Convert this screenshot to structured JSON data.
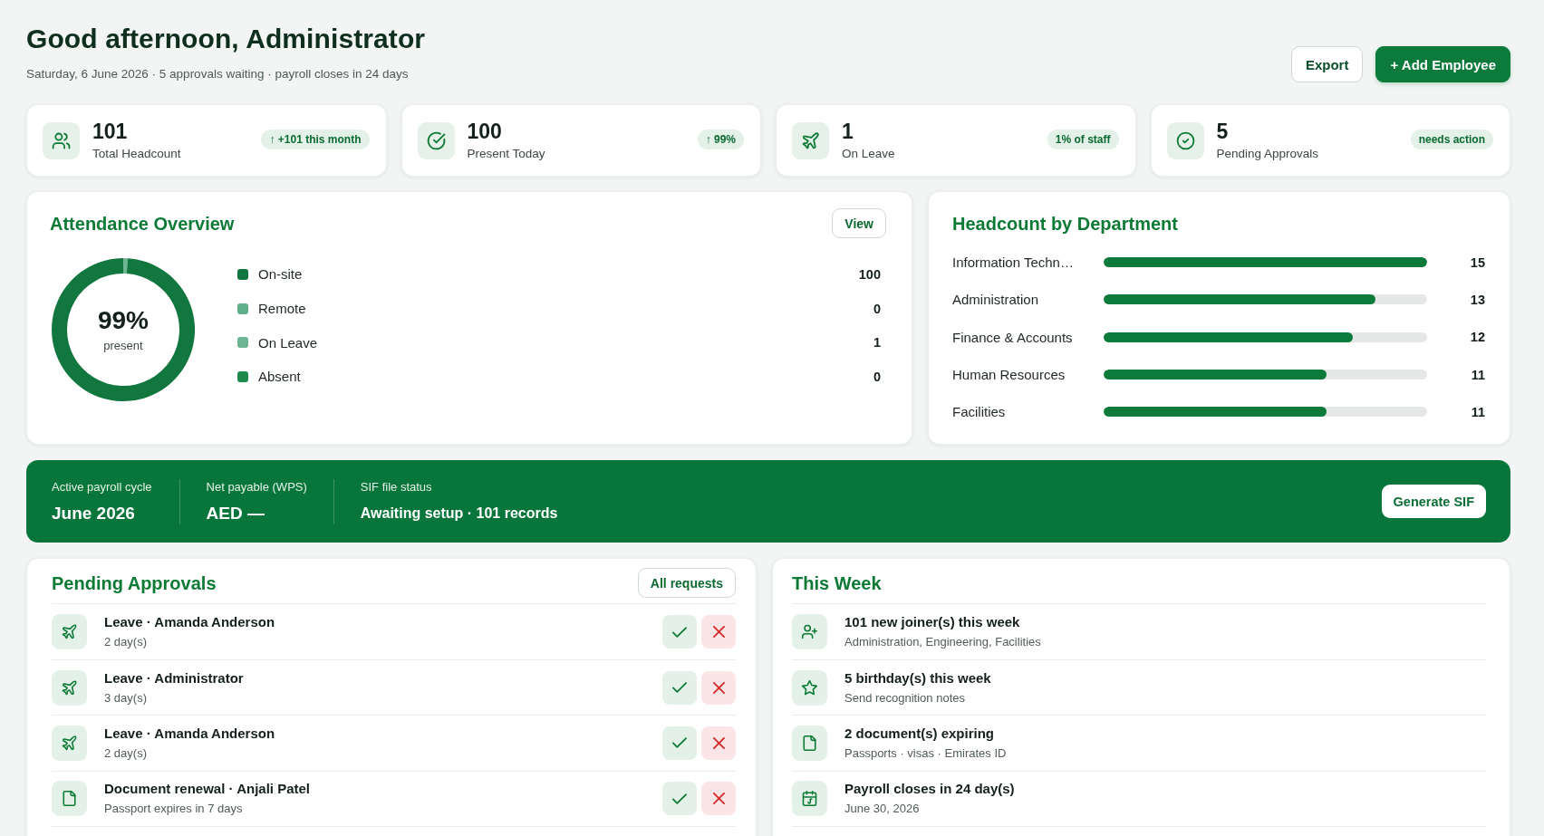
{
  "header": {
    "title": "Good afternoon, Administrator",
    "subtitle": "Saturday, 6 June 2026 · 5 approvals waiting · payroll closes in 24 days",
    "buttons": [
      {
        "label": "Export",
        "kind": "secondary"
      },
      {
        "label": "+ Add Employee",
        "kind": "primary"
      }
    ]
  },
  "stats": [
    {
      "kind": "headcount",
      "value": "101",
      "label": "Total Headcount",
      "badge": "↑ +101 this month"
    },
    {
      "kind": "present",
      "value": "100",
      "label": "Present Today",
      "badge": "↑ 99%"
    },
    {
      "kind": "leave",
      "value": "1",
      "label": "On Leave",
      "badge": "1% of staff"
    },
    {
      "kind": "approvals",
      "value": "5",
      "label": "Pending Approvals",
      "badge": "needs action"
    }
  ],
  "attendance": {
    "title": "Attendance Overview",
    "action": "View",
    "center_value": "99%",
    "center_label": "present",
    "chart_data": {
      "type": "donut",
      "series": [
        {
          "color": "#6cb592",
          "values": [
            1
          ]
        },
        {
          "color": "#12773e",
          "values": [
            100
          ]
        }
      ]
    },
    "legend": [
      {
        "label": "On-site",
        "value": "100",
        "color": "#12773e"
      },
      {
        "label": "Remote",
        "value": "0",
        "color": "#5fb088"
      },
      {
        "label": "On Leave",
        "value": "1",
        "color": "#6cb592"
      },
      {
        "label": "Absent",
        "value": "0",
        "color": "#1d8a4b"
      }
    ]
  },
  "headcount": {
    "title": "Headcount by Department",
    "departments": [
      {
        "name": "Information Techn…",
        "level": 1,
        "count": "15"
      },
      {
        "name": "Administration",
        "level": 0.84,
        "count": "13"
      },
      {
        "name": "Finance & Accounts",
        "level": 0.77,
        "count": "12"
      },
      {
        "name": "Human Resources",
        "level": 0.69,
        "count": "11"
      },
      {
        "name": "Facilities",
        "level": 0.69,
        "count": "11"
      }
    ]
  },
  "payroll": {
    "fields": [
      {
        "kind": "figure",
        "label": "Active payroll cycle",
        "value": "June 2026"
      },
      {
        "kind": "figure",
        "label": "Net payable (WPS)",
        "value": "AED —"
      },
      {
        "kind": "status",
        "label": "SIF file status",
        "value": "Awaiting setup · 101 records"
      }
    ],
    "action": "Generate SIF"
  },
  "approvals": {
    "title": "Pending Approvals",
    "action": "All requests",
    "items": [
      {
        "kind": "leave",
        "title": "Leave · Amanda Anderson",
        "detail": "2 day(s)"
      },
      {
        "kind": "leave",
        "title": "Leave · Administrator",
        "detail": "3 day(s)"
      },
      {
        "kind": "leave",
        "title": "Leave · Amanda Anderson",
        "detail": "2 day(s)"
      },
      {
        "kind": "document",
        "title": "Document renewal · Anjali Patel",
        "detail": "Passport expires in 7 days"
      }
    ]
  },
  "this_week": {
    "title": "This Week",
    "items": [
      {
        "kind": "joiners",
        "title": "101 new joiner(s) this week",
        "detail": "Administration, Engineering, Facilities"
      },
      {
        "kind": "birthdays",
        "title": "5 birthday(s) this week",
        "detail": "Send recognition notes"
      },
      {
        "kind": "documents",
        "title": "2 document(s) expiring",
        "detail": "Passports · visas · Emirates ID"
      },
      {
        "kind": "payroll",
        "title": "Payroll closes in 24 day(s)",
        "detail": "June 30, 2026"
      }
    ]
  }
}
